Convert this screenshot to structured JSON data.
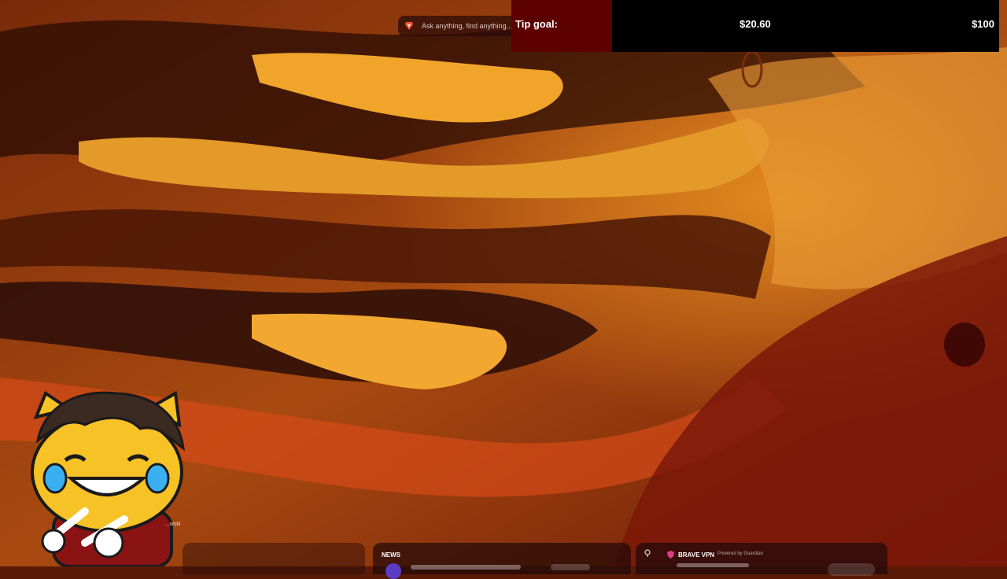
{
  "search": {
    "placeholder": "Ask anything, find anything..."
  },
  "tip_goal": {
    "label": "Tip goal:",
    "current": "$20.60",
    "target": "$100",
    "progress_fraction": 0.206
  },
  "mascot": {
    "caption": "...wski"
  },
  "widgets": {
    "news": {
      "title": "NEWS"
    },
    "vpn": {
      "title": "BRAVE VPN",
      "powered_by": "Powered by Guardian"
    }
  },
  "colors": {
    "tip_fill": "#5c0000",
    "tip_bg": "#000000",
    "mascot_yellow": "#f7c226"
  }
}
